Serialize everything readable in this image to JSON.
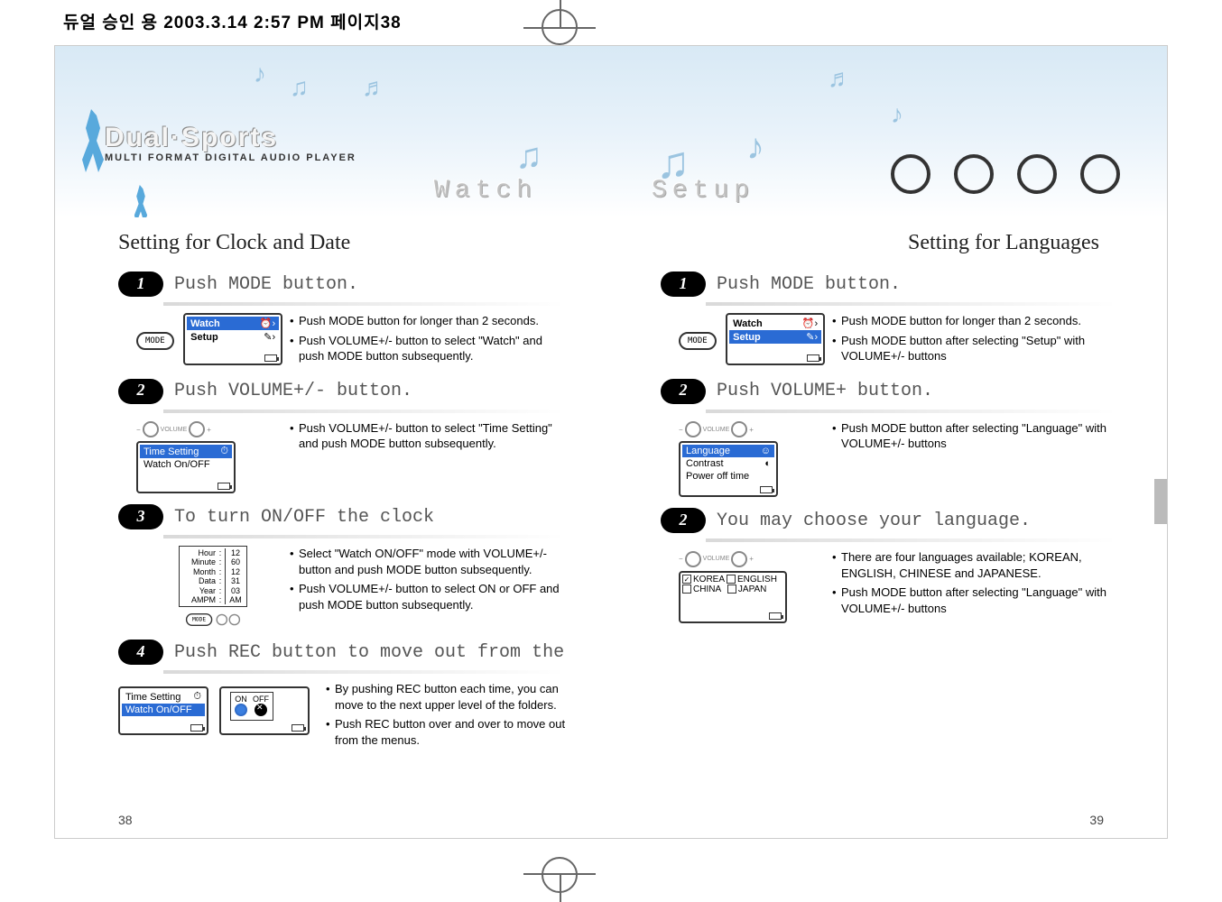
{
  "printmark": "듀얼 승인 용  2003.3.14 2:57 PM 페이지38",
  "wordmark": "Dual·Sports",
  "subwordmark": "MULTI FORMAT DIGITAL AUDIO PLAYER",
  "ghost_watch": "Watch",
  "ghost_setup": "Setup",
  "left": {
    "title": "Setting for Clock and Date",
    "pagenum": "38",
    "steps": [
      {
        "num": "1",
        "title": "Push MODE button.",
        "screen": {
          "rows": [
            [
              "Watch",
              "⏰›"
            ],
            [
              "Setup",
              "✎›"
            ]
          ],
          "hl": 0
        },
        "btn": "MODE",
        "bullets": [
          "Push MODE button for longer than 2 seconds.",
          "Push VOLUME+/- button to select \"Watch\" and push MODE button subsequently."
        ]
      },
      {
        "num": "2",
        "title": "Push VOLUME+/- button.",
        "screen": {
          "rows": [
            [
              "Time Setting",
              "⏱"
            ],
            [
              "Watch On/OFF",
              ""
            ]
          ],
          "hl": 0
        },
        "vol": true,
        "bullets": [
          "Push VOLUME+/- button to select \"Time Setting\" and push MODE button subsequently."
        ]
      },
      {
        "num": "3",
        "title": "To turn ON/OFF the clock",
        "timegrid": [
          [
            "Hour",
            "12"
          ],
          [
            "Minute",
            "60"
          ],
          [
            "Month",
            "12"
          ],
          [
            "Data",
            "31"
          ],
          [
            "Year",
            "03"
          ],
          [
            "AMPM",
            "AM"
          ]
        ],
        "bullets": [
          "Select \"Watch ON/OFF\" mode with VOLUME+/- button and push MODE button subsequently.",
          "Push VOLUME+/- button to select ON or OFF and push MODE button subsequently."
        ]
      },
      {
        "num": "4",
        "title": "Push REC button to move out from the",
        "miniscreenA": {
          "rows": [
            [
              "Time Setting",
              "⏱"
            ],
            [
              "Watch On/OFF",
              ""
            ]
          ],
          "hl": 1
        },
        "onoff": {
          "on": "ON",
          "off": "OFF"
        },
        "bullets": [
          "By pushing REC button each time, you can move to the next upper level of the folders.",
          "Push REC button over and over to move out from the menus."
        ]
      }
    ]
  },
  "right": {
    "title": "Setting for Languages",
    "pagenum": "39",
    "steps": [
      {
        "num": "1",
        "title": "Push MODE button.",
        "screen": {
          "rows": [
            [
              "Watch",
              "⏰›"
            ],
            [
              "Setup",
              "✎›"
            ]
          ],
          "hl": 1
        },
        "btn": "MODE",
        "bullets": [
          "Push MODE button for longer than 2 seconds.",
          "Push MODE button after selecting \"Setup\" with VOLUME+/- buttons"
        ]
      },
      {
        "num": "2",
        "title": "Push VOLUME+ button.",
        "screen": {
          "rows": [
            [
              "Language",
              "☺"
            ],
            [
              "Contrast",
              "◐"
            ],
            [
              "Power off time",
              ""
            ]
          ],
          "hl": 0
        },
        "vol": true,
        "bullets": [
          "Push MODE button after selecting \"Language\" with VOLUME+/- buttons"
        ]
      },
      {
        "num": "2",
        "title": "You may choose your language.",
        "langgrid": [
          [
            [
              "☑",
              "KOREA"
            ],
            [
              "☐",
              "ENGLISH"
            ]
          ],
          [
            [
              "☐",
              "CHINA"
            ],
            [
              "☐",
              "JAPAN"
            ]
          ]
        ],
        "vol": true,
        "bullets": [
          "There are four languages available; KOREAN, ENGLISH, CHINESE and JAPANESE.",
          "Push MODE button after selecting \"Language\" with VOLUME+/- buttons"
        ]
      }
    ]
  },
  "vol_minus": "−",
  "vol_label": "VOLUME",
  "vol_plus": "+"
}
